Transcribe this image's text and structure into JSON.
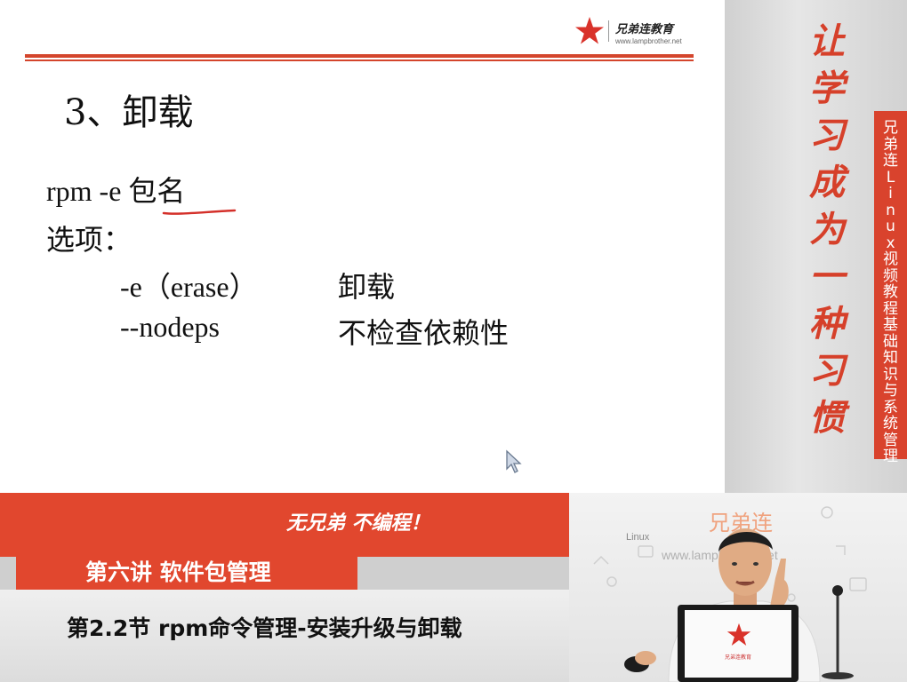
{
  "slide": {
    "logo_brand": "兄弟连教育",
    "logo_url": "www.lampbrother.net",
    "title": "3、卸载",
    "command": "rpm  -e  包名",
    "options_label": "选项：",
    "options": [
      {
        "flag": "-e（erase）",
        "desc": "卸载"
      },
      {
        "flag": "--nodeps",
        "desc": "不检查依赖性"
      }
    ]
  },
  "banner": {
    "slogan_chars": [
      "让",
      "学",
      "习",
      "成",
      "为",
      "一",
      "种",
      "习",
      "惯"
    ],
    "vertical_chars": [
      "兄",
      "弟",
      "连",
      "L",
      "i",
      "n",
      "u",
      "x",
      "视",
      "频",
      "教",
      "程",
      " ",
      "基",
      "础",
      "知",
      "识",
      "与",
      "系",
      "统",
      "管",
      "理"
    ]
  },
  "bottom": {
    "motto": "无兄弟 不编程！",
    "lecture": "第六讲 软件包管理",
    "section": "第2.2节  rpm命令管理-安装升级与卸载"
  },
  "webcam": {
    "watermark": "兄弟连",
    "linux_label": "Linux",
    "url": "www.lampbrother.net"
  },
  "colors": {
    "accent_red": "#e1472e",
    "slide_bg": "#ffffff"
  }
}
